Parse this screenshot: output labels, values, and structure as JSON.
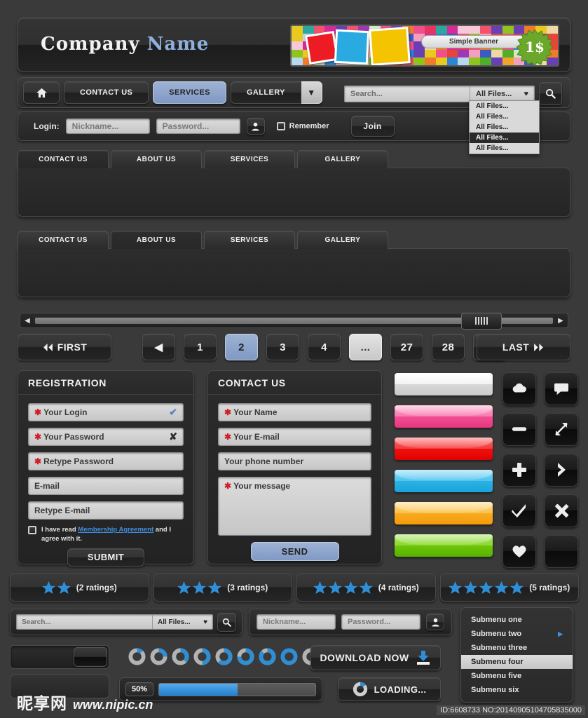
{
  "header": {
    "company_primary": "Company",
    "company_accent": "Name",
    "banner_label": "Simple Banner",
    "banner_price": "1$"
  },
  "nav": {
    "home_icon": "home-icon",
    "items": [
      {
        "label": "CONTACT US",
        "active": false
      },
      {
        "label": "SERVICES",
        "active": true
      },
      {
        "label": "GALLERY",
        "active": false
      }
    ],
    "dropdown_arrow": "▼"
  },
  "search": {
    "placeholder": "Search...",
    "filter_value": "All Files...",
    "filter_arrow": "♥",
    "go_icon": "search-icon",
    "dropdown_options": [
      "All Files...",
      "All Files...",
      "All Files...",
      "All Files...",
      "All Files..."
    ],
    "dropdown_selected_index": 3
  },
  "login": {
    "label": "Login:",
    "nickname_placeholder": "Nickname...",
    "password_placeholder": "Password...",
    "user_icon": "user-icon",
    "remember_label": "Remember",
    "join_label": "Join"
  },
  "tabsets": [
    {
      "tabs": [
        "CONTACT US",
        "ABOUT US",
        "SERVICES",
        "GALLERY"
      ],
      "active_index": 0
    },
    {
      "tabs": [
        "CONTACT US",
        "ABOUT US",
        "SERVICES",
        "GALLERY"
      ],
      "active_index": 1
    }
  ],
  "scrollbar": {
    "left_arrow": "◀",
    "right_arrow": "▶"
  },
  "pagination": {
    "first_label": "FIRST",
    "last_label": "LAST",
    "first_icon": "double-chevron-left-icon",
    "last_icon": "double-chevron-right-icon",
    "pages": [
      {
        "label": "◀",
        "kind": "prev"
      },
      {
        "label": "1",
        "kind": "num"
      },
      {
        "label": "2",
        "kind": "num-active"
      },
      {
        "label": "3",
        "kind": "num"
      },
      {
        "label": "4",
        "kind": "num"
      },
      {
        "label": "...",
        "kind": "ellipsis"
      },
      {
        "label": "27",
        "kind": "num"
      },
      {
        "label": "28",
        "kind": "num"
      },
      {
        "label": "▶",
        "kind": "next"
      }
    ]
  },
  "registration": {
    "title": "REGISTRATION",
    "fields": [
      {
        "label": "Your Login",
        "required": true,
        "state": "ok"
      },
      {
        "label": "Your Password",
        "required": true,
        "state": "bad"
      },
      {
        "label": "Retype Password",
        "required": true,
        "state": "none"
      },
      {
        "label": "E-mail",
        "required": false,
        "state": "none"
      },
      {
        "label": "Retype E-mail",
        "required": false,
        "state": "none"
      }
    ],
    "agree_pre": "I have read ",
    "agree_link": "Membership Agreement",
    "agree_post": " and I agree with it.",
    "submit_label": "SUBMIT"
  },
  "contact": {
    "title": "CONTACT US",
    "fields": [
      {
        "label": "Your Name",
        "required": true
      },
      {
        "label": "Your E-mail",
        "required": true
      },
      {
        "label": "Your phone number",
        "required": false
      }
    ],
    "message_label": "Your message",
    "message_required": true,
    "send_label": "SEND"
  },
  "color_bars": [
    {
      "name": "white",
      "color": "#f2f2f2",
      "shade": "#c9c9c9"
    },
    {
      "name": "pink",
      "color": "#f978b0",
      "shade": "#e8357f"
    },
    {
      "name": "red",
      "color": "#f43b3b",
      "shade": "#e00000"
    },
    {
      "name": "blue",
      "color": "#4fc3ef",
      "shade": "#18a3db"
    },
    {
      "name": "orange",
      "color": "#fbc14a",
      "shade": "#f59a08"
    },
    {
      "name": "green",
      "color": "#8bd82f",
      "shade": "#56b200"
    }
  ],
  "icon_buttons": [
    {
      "icon": "cloud-upload-icon"
    },
    {
      "icon": "chat-bubble-icon"
    },
    {
      "icon": "minus-icon"
    },
    {
      "icon": "expand-arrows-icon"
    },
    {
      "icon": "plus-icon"
    },
    {
      "icon": "chevron-right-icon"
    },
    {
      "icon": "check-icon"
    },
    {
      "icon": "close-x-icon"
    },
    {
      "icon": "heart-icon"
    },
    {
      "icon": "blank-icon"
    }
  ],
  "ratings": [
    {
      "stars": 2,
      "label": "(2 ratings)"
    },
    {
      "stars": 3,
      "label": "(3 ratings)"
    },
    {
      "stars": 4,
      "label": "(4 ratings)"
    },
    {
      "stars": 5,
      "label": "(5 ratings)"
    }
  ],
  "mini_search": {
    "placeholder": "Search...",
    "filter_value": "All Files...",
    "filter_arrow": "♥",
    "go_icon": "search-icon"
  },
  "mini_login": {
    "nickname_placeholder": "Nickname...",
    "password_placeholder": "Password...",
    "user_icon": "user-icon"
  },
  "submenu": {
    "items": [
      {
        "label": "Submenu one",
        "has_arrow": false,
        "selected": false
      },
      {
        "label": "Submenu two",
        "has_arrow": true,
        "selected": false
      },
      {
        "label": "Submenu three",
        "has_arrow": false,
        "selected": false
      },
      {
        "label": "Submenu four",
        "has_arrow": false,
        "selected": true
      },
      {
        "label": "Submenu five",
        "has_arrow": false,
        "selected": false
      },
      {
        "label": "Submenu six",
        "has_arrow": false,
        "selected": false
      }
    ],
    "arrow_glyph": "▶"
  },
  "download": {
    "label": "DOWNLOAD NOW",
    "icon": "download-icon"
  },
  "progress": {
    "percent_label": "50%",
    "percent_value": 50
  },
  "loading": {
    "label": "LOADING...",
    "icon": "spinner-icon"
  },
  "spinners": {
    "count": 9,
    "accent": "#2f8fd6",
    "track": "#b3b3b3"
  },
  "colors": {
    "accent_blue": "#8099c4",
    "link_blue": "#3f8fe0",
    "required_red": "#cc2026",
    "star_blue": "#2f8fd6",
    "progress_blue": "#1f7fd0"
  },
  "watermark": {
    "cn": "昵享网",
    "url": "www.nipic.cn"
  },
  "id_line": "ID:6608733 NO:20140905104705835000"
}
